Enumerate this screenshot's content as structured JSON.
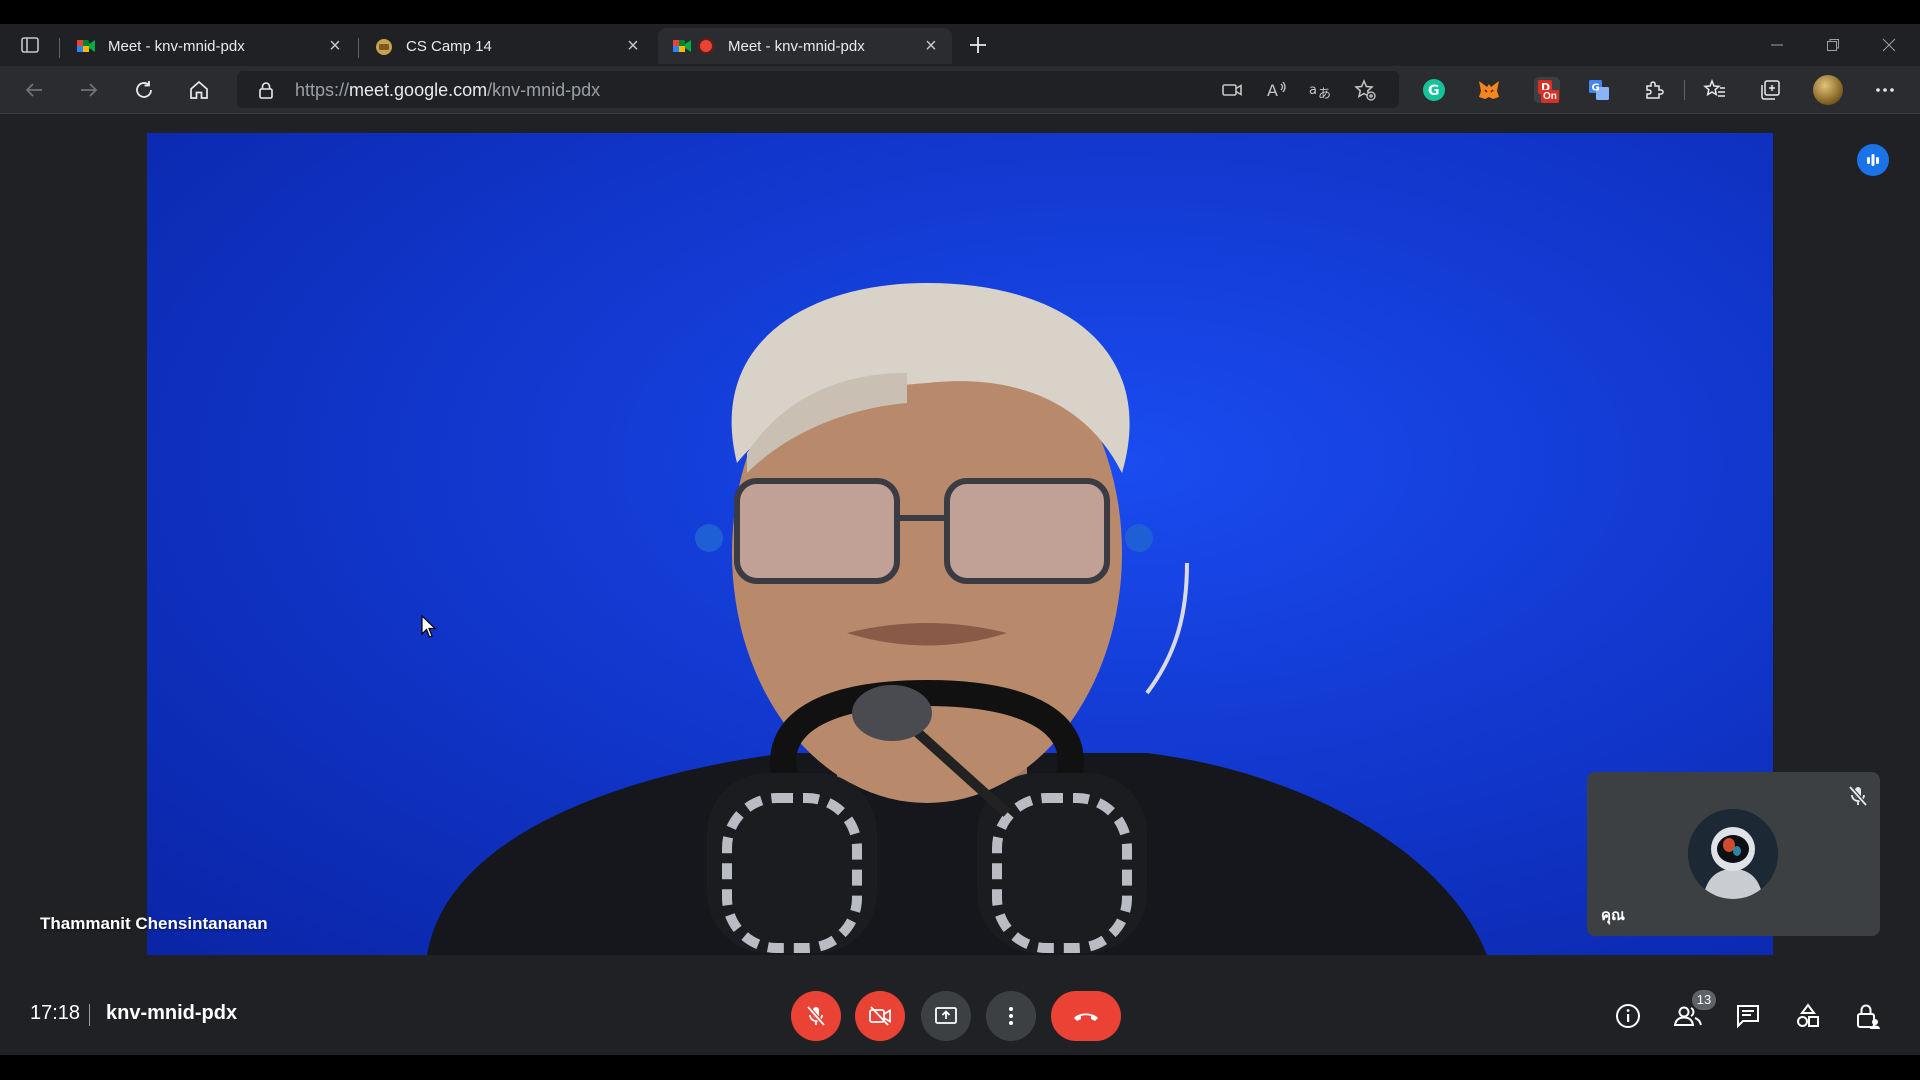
{
  "browser": {
    "tabs": [
      {
        "title": "Meet - knv-mnid-pdx",
        "active": false,
        "icon": "google-meet-icon"
      },
      {
        "title": "CS Camp 14",
        "active": false,
        "icon": "camp-logo-icon"
      },
      {
        "title": "Meet - knv-mnid-pdx",
        "active": true,
        "icon": "google-meet-icon",
        "recording": true
      }
    ],
    "url": {
      "scheme": "https://",
      "host": "meet.google.com",
      "path": "/knv-mnid-pdx"
    },
    "extensions": [
      "grammarly-icon",
      "metamask-icon",
      "on-extension-icon",
      "translate-icon",
      "extensions-puzzle-icon"
    ],
    "ext_badge": "On"
  },
  "meeting": {
    "speaker_name": "Thammanit Chensintananan",
    "self_name": "คุณ",
    "time": "17:18",
    "code": "knv-mnid-pdx",
    "participant_count": "13"
  },
  "colors": {
    "leave_red": "#ea4335",
    "video_blue": "#1238cf",
    "meet_bg": "#202124",
    "active_speaker_blue": "#8ab4f8"
  }
}
